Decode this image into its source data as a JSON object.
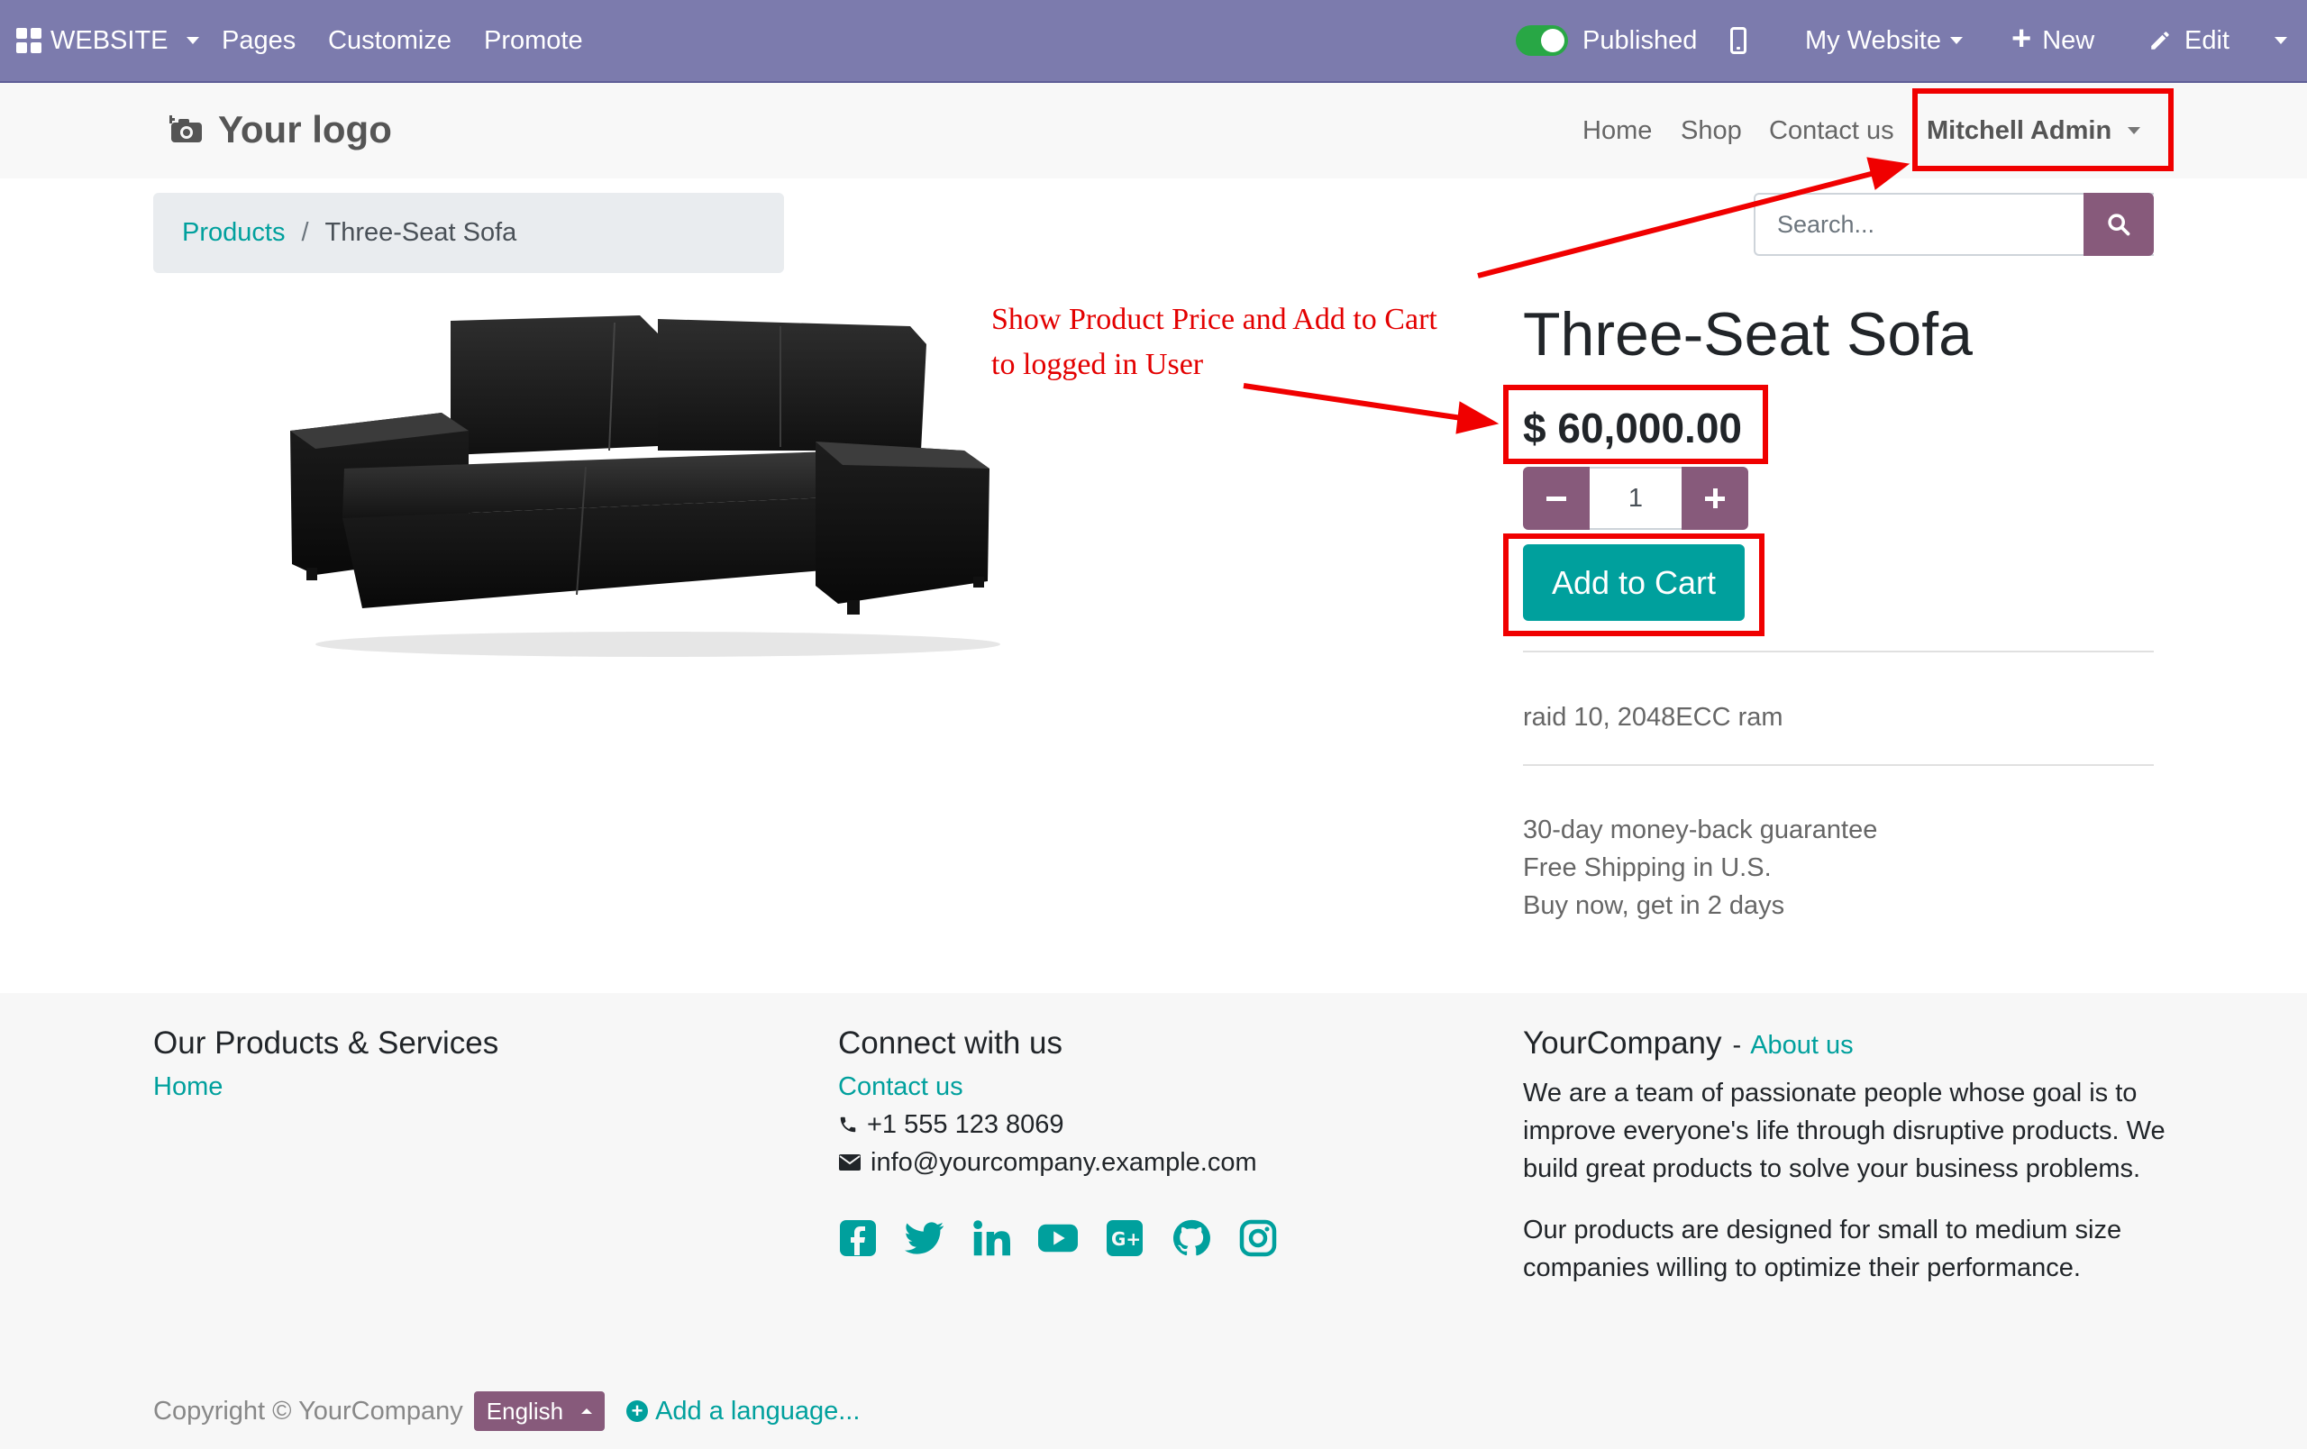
{
  "admin_bar": {
    "website_label": "WEBSITE",
    "pages_label": "Pages",
    "customize_label": "Customize",
    "promote_label": "Promote",
    "published_label": "Published",
    "my_website_label": "My Website",
    "new_label": "New",
    "edit_label": "Edit",
    "published_toggle_on": true,
    "bar_color": "#7c7bad"
  },
  "header": {
    "logo_text": "Your logo",
    "nav": {
      "home": "Home",
      "shop": "Shop",
      "contact": "Contact us",
      "user": "Mitchell Admin"
    }
  },
  "breadcrumb": {
    "parent": "Products",
    "separator": "/",
    "current": "Three-Seat Sofa"
  },
  "search": {
    "placeholder": "Search..."
  },
  "product": {
    "name": "Three-Seat Sofa",
    "price": "$ 60,000.00",
    "quantity": "1",
    "add_to_cart": "Add to Cart",
    "description": "raid 10, 2048ECC ram",
    "guarantees": [
      "30-day money-back guarantee",
      "Free Shipping in U.S.",
      "Buy now, get in 2 days"
    ]
  },
  "annotation": {
    "line1": "Show Product Price and Add to Cart",
    "line2": "to logged in User",
    "color": "#e30000"
  },
  "footer": {
    "col1": {
      "heading": "Our Products & Services",
      "link": "Home"
    },
    "col2": {
      "heading": "Connect with us",
      "link": "Contact us",
      "phone": "+1 555 123 8069",
      "email": "info@yourcompany.example.com",
      "social_icons": [
        "facebook-icon",
        "twitter-icon",
        "linkedin-icon",
        "youtube-icon",
        "google-plus-icon",
        "github-icon",
        "instagram-icon"
      ]
    },
    "col3": {
      "company": "YourCompany",
      "dash": "-",
      "about_link": "About us",
      "para1": "We are a team of passionate people whose goal is to improve everyone's life through disruptive products. We build great products to solve your business problems.",
      "para2": "Our products are designed for small to medium size companies willing to optimize their performance."
    },
    "copyright": "Copyright © YourCompany",
    "language": "English",
    "add_language": "Add a language..."
  },
  "colors": {
    "accent": "#00a09d",
    "primary": "#875a7b",
    "highlight": "#f00000"
  }
}
